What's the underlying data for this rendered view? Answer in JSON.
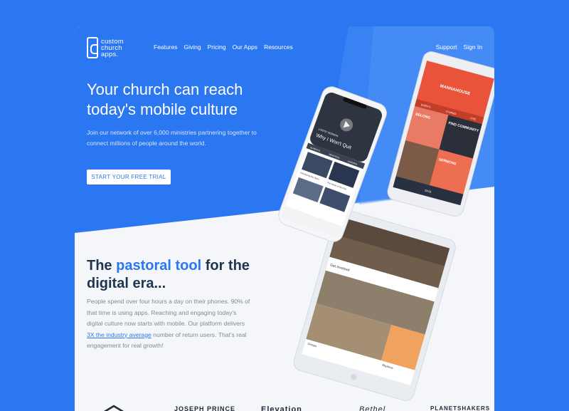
{
  "brand": {
    "line1": "custom",
    "line2": "church",
    "line3": "apps."
  },
  "nav": {
    "items": [
      "Features",
      "Giving",
      "Pricing",
      "Our Apps",
      "Resources"
    ],
    "support": "Support",
    "signin": "Sign In"
  },
  "hero": {
    "title": "Your church can reach today's mobile culture",
    "subtitle": "Join our network of over 6,000 ministries partnering together to connect millions of people around the world.",
    "cta": "START YOUR FREE TRIAL"
  },
  "section": {
    "title_pre": "The ",
    "title_highlight": "pastoral tool",
    "title_post": " for the digital era...",
    "body_pre": "People spend over four hours a day on their phones. 90% of that time is using apps. Reaching and engaging today's digital culture now starts with mobile. Our platform delivers ",
    "body_link": "3X the industry average",
    "body_post": " number of return users. That's real engagement for real growth!"
  },
  "phone_left": {
    "tag": "LATEST SERMON",
    "heading": "Why I Won't Quit",
    "tabs": [
      "SUNDAYS",
      "DEVOTION",
      "LEADERS"
    ],
    "card_titles": [
      "Introducing the Team",
      "The Name of the Fire"
    ]
  },
  "phone_right": {
    "church": "MANNAHOUSE",
    "tabs": [
      "EVENTS",
      "STORIES",
      "LIVE"
    ],
    "tiles": [
      "BELONG",
      "FIND COMMUNITY",
      "SERMONS"
    ],
    "bar_label": "GIVE"
  },
  "tablet": {
    "label": "Get Involved",
    "card1": "Groups",
    "card2": "Rhythms"
  },
  "partner_logos": [
    "JOSEPH PRINCE",
    "Elevation",
    "Bethel",
    "PLANETSHAKERS"
  ],
  "colors": {
    "primary": "#2B77F2",
    "heading": "#1E3550",
    "body": "#7F8B98",
    "accent_red": "#E8533A"
  }
}
